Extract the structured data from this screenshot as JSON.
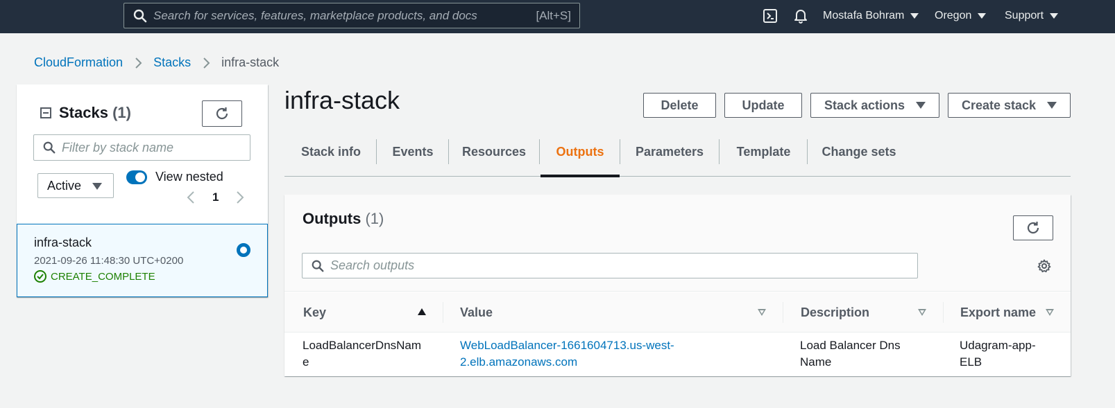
{
  "topnav": {
    "search_placeholder": "Search for services, features, marketplace products, and docs",
    "search_shortcut": "[Alt+S]",
    "user": "Mostafa Bohram",
    "region": "Oregon",
    "support": "Support",
    "icons": [
      "search-icon",
      "cloudshell-icon",
      "bell-icon"
    ]
  },
  "breadcrumb": {
    "items": [
      "CloudFormation",
      "Stacks",
      "infra-stack"
    ]
  },
  "sidebar": {
    "title": "Stacks",
    "count": "(1)",
    "filter_placeholder": "Filter by stack name",
    "status_filter": "Active",
    "view_nested_label": "View nested",
    "view_nested_on": true,
    "page": "1",
    "stack": {
      "name": "infra-stack",
      "created": "2021-09-26 11:48:30 UTC+0200",
      "status": "CREATE_COMPLETE",
      "selected": true
    }
  },
  "main": {
    "title": "infra-stack",
    "actions": {
      "delete": "Delete",
      "update": "Update",
      "stack_actions": "Stack actions",
      "create_stack": "Create stack"
    },
    "tabs": [
      "Stack info",
      "Events",
      "Resources",
      "Outputs",
      "Parameters",
      "Template",
      "Change sets"
    ],
    "active_tab": "Outputs",
    "outputs": {
      "title": "Outputs",
      "count": "(1)",
      "search_placeholder": "Search outputs",
      "columns": [
        "Key",
        "Value",
        "Description",
        "Export name"
      ],
      "rows": [
        {
          "key_line1": "LoadBalancerDnsNam",
          "key_line2": "e",
          "value_line1": "WebLoadBalancer-1661604713.us-west-",
          "value_line2": "2.elb.amazonaws.com",
          "desc_line1": "Load Balancer Dns",
          "desc_line2": "Name",
          "export_line1": "Udagram-app-",
          "export_line2": "ELB"
        }
      ]
    }
  },
  "colors": {
    "nav_bg": "#232f3e",
    "link": "#0073bb",
    "active_tab": "#ec7211",
    "success": "#1d8102"
  }
}
